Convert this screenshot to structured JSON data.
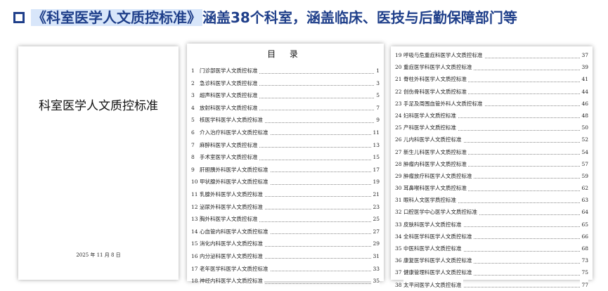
{
  "header": {
    "highlight": "《科室医学人文质控标准》",
    "rest": "涵盖38个科室，涵盖临床、医技与后勤保障部门等",
    "accent_color": "#1f3f8a",
    "highlight_color": "#d8e6fa"
  },
  "cover": {
    "title": "科室医学人文质控标准",
    "date": "2025 年 11 月 8 日"
  },
  "toc1": {
    "heading": "目 录",
    "items": [
      {
        "num": "1",
        "title": "门诊部医学人文质控标准",
        "page": "1"
      },
      {
        "num": "2",
        "title": "急诊科医学人文质控标准",
        "page": "3"
      },
      {
        "num": "3",
        "title": "超声科医学人文质控标准",
        "page": "5"
      },
      {
        "num": "4",
        "title": "放射科医学人文质控标准",
        "page": "7"
      },
      {
        "num": "5",
        "title": "核医学科医学人文质控标准",
        "page": "9"
      },
      {
        "num": "6",
        "title": "介入治疗科医学人文质控标准",
        "page": "11"
      },
      {
        "num": "7",
        "title": "麻醉科医学人文质控标准",
        "page": "13"
      },
      {
        "num": "8",
        "title": "手术室医学人文质控标准",
        "page": "15"
      },
      {
        "num": "9",
        "title": "肝胆胰外科医学人文质控标准",
        "page": "17"
      },
      {
        "num": "10",
        "title": "甲状腺外科医学人文质控标准",
        "page": "19"
      },
      {
        "num": "11",
        "title": "乳腺外科医学人文质控标准",
        "page": "21"
      },
      {
        "num": "12",
        "title": "泌尿外科医学人文质控标准",
        "page": "23"
      },
      {
        "num": "13",
        "title": "胸外科医学人文质控标准",
        "page": "25"
      },
      {
        "num": "14",
        "title": "心血管内科医学人文质控标准",
        "page": "27"
      },
      {
        "num": "15",
        "title": "消化内科医学人文质控标准",
        "page": "29"
      },
      {
        "num": "16",
        "title": "内分泌科医学人文质控标准",
        "page": "31"
      },
      {
        "num": "17",
        "title": "老年医学科医学人文质控标准",
        "page": "33"
      },
      {
        "num": "18",
        "title": "神经内科医学人文质控标准",
        "page": "35"
      }
    ]
  },
  "toc2": {
    "items": [
      {
        "num": "19",
        "title": "呼吸与危重症科医学人文质控标准",
        "page": "37"
      },
      {
        "num": "20",
        "title": "重症医学科医学人文质控标准",
        "page": "39"
      },
      {
        "num": "21",
        "title": "脊柱外科医学人文质控标准",
        "page": "41"
      },
      {
        "num": "22",
        "title": "创伤骨科医学人文质控标准",
        "page": "44"
      },
      {
        "num": "23",
        "title": "手足及周围血管外科人文质控标准",
        "page": "46"
      },
      {
        "num": "24",
        "title": "妇科医学人文质控标准",
        "page": "48"
      },
      {
        "num": "25",
        "title": "产科医学人文质控标准",
        "page": "50"
      },
      {
        "num": "26",
        "title": "儿内科医学人文质控标准",
        "page": "52"
      },
      {
        "num": "27",
        "title": "新生儿科医学人文质控标准",
        "page": "54"
      },
      {
        "num": "28",
        "title": "肿瘤内科医学人文质控标准",
        "page": "57"
      },
      {
        "num": "29",
        "title": "肿瘤放疗科医学人文质控标准",
        "page": "59"
      },
      {
        "num": "30",
        "title": "耳鼻喉科医学人文质控标准",
        "page": "62"
      },
      {
        "num": "31",
        "title": "眼科人文医学质控标准",
        "page": "63"
      },
      {
        "num": "32",
        "title": "口腔医学中心医学人文质控标准",
        "page": "64"
      },
      {
        "num": "33",
        "title": "皮肤科医学人文质控标准",
        "page": "65"
      },
      {
        "num": "34",
        "title": "全科医学科医学人文质控标准",
        "page": "66"
      },
      {
        "num": "35",
        "title": "中医科医学人文质控标准",
        "page": "68"
      },
      {
        "num": "36",
        "title": "康复医学科医学人文质控标准",
        "page": "73"
      },
      {
        "num": "37",
        "title": "健康管理科医学人文质控标准",
        "page": "75"
      },
      {
        "num": "38",
        "title": "太平间医学人文质控标准",
        "page": "77"
      }
    ]
  }
}
